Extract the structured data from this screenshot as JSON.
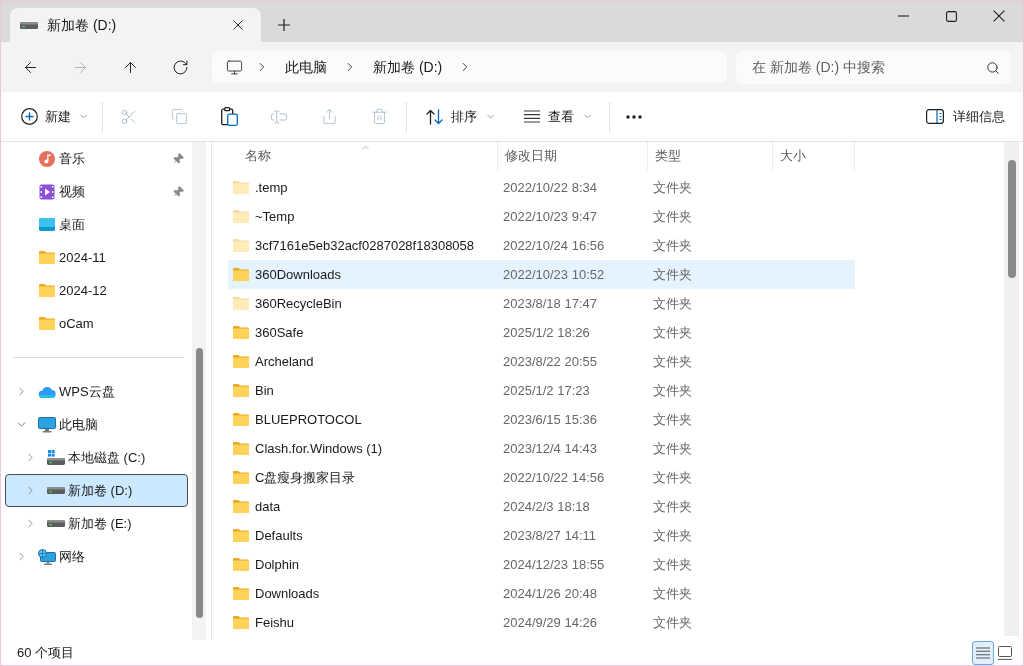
{
  "window": {
    "tabs": [
      {
        "title": "新加卷 (D:)",
        "selected": true
      }
    ]
  },
  "nav_buttons": [
    {
      "kind": "back",
      "disabled": false
    },
    {
      "kind": "forward",
      "disabled": true
    },
    {
      "kind": "up",
      "disabled": false
    },
    {
      "kind": "refresh",
      "disabled": false
    }
  ],
  "address_bar": {
    "path": [
      "此电脑",
      "新加卷 (D:)"
    ]
  },
  "search": {
    "placeholder": "在 新加卷 (D:) 中搜索"
  },
  "toolbar": {
    "new": {
      "label": "新建"
    },
    "actions": [
      {
        "kind": "cut",
        "disabled": true
      },
      {
        "kind": "copy",
        "disabled": true
      },
      {
        "kind": "paste",
        "disabled": false
      },
      {
        "kind": "rename",
        "disabled": true
      },
      {
        "kind": "share",
        "disabled": true
      },
      {
        "kind": "delete",
        "disabled": true
      }
    ],
    "sort": {
      "label": "排序"
    },
    "view": {
      "label": "查看"
    },
    "details": {
      "label": "详细信息"
    }
  },
  "sidebar": {
    "quick_access": [
      {
        "label": "音乐",
        "kind": "music",
        "pinned": true,
        "selected": false
      },
      {
        "label": "视频",
        "kind": "video",
        "pinned": true,
        "selected": false
      },
      {
        "label": "桌面",
        "kind": "desktop",
        "pinned": false,
        "selected": false
      },
      {
        "label": "2024-11",
        "kind": "folder",
        "pinned": false,
        "selected": false
      },
      {
        "label": "2024-12",
        "kind": "folder",
        "pinned": false,
        "selected": false
      },
      {
        "label": "oCam",
        "kind": "folder",
        "pinned": false,
        "selected": false
      }
    ],
    "tree": [
      {
        "label": "WPS云盘",
        "kind": "cloud",
        "expanded": false,
        "selected": false
      },
      {
        "label": "此电脑",
        "kind": "pc",
        "expanded": true,
        "selected": false,
        "children": [
          {
            "label": "本地磁盘 (C:)",
            "kind": "system_drive",
            "expanded": false,
            "selected": false
          },
          {
            "label": "新加卷 (D:)",
            "kind": "drive",
            "expanded": false,
            "selected": true
          },
          {
            "label": "新加卷 (E:)",
            "kind": "drive",
            "expanded": false,
            "selected": false
          }
        ]
      },
      {
        "label": "网络",
        "kind": "network",
        "expanded": false,
        "selected": false
      }
    ]
  },
  "table": {
    "columns": [
      {
        "label": "名称",
        "sorted": true
      },
      {
        "label": "修改日期",
        "sorted": false
      },
      {
        "label": "类型",
        "sorted": false
      },
      {
        "label": "大小",
        "sorted": false
      }
    ],
    "rows": [
      {
        "name": ".temp",
        "modified": "2022/10/22 8:34",
        "type": "文件夹",
        "hidden": true,
        "hovered": false,
        "selected": false
      },
      {
        "name": "~Temp",
        "modified": "2022/10/23 9:47",
        "type": "文件夹",
        "hidden": true,
        "hovered": false,
        "selected": false
      },
      {
        "name": "3cf7161e5eb32acf0287028f18308058",
        "modified": "2022/10/24 16:56",
        "type": "文件夹",
        "hidden": true,
        "hovered": false,
        "selected": false
      },
      {
        "name": "360Downloads",
        "modified": "2022/10/23 10:52",
        "type": "文件夹",
        "hidden": false,
        "hovered": true,
        "selected": false
      },
      {
        "name": "360RecycleBin",
        "modified": "2023/8/18 17:47",
        "type": "文件夹",
        "hidden": true,
        "hovered": false,
        "selected": false
      },
      {
        "name": "360Safe",
        "modified": "2025/1/2 18:26",
        "type": "文件夹",
        "hidden": false,
        "hovered": false,
        "selected": false
      },
      {
        "name": "Archeland",
        "modified": "2023/8/22 20:55",
        "type": "文件夹",
        "hidden": false,
        "hovered": false,
        "selected": false
      },
      {
        "name": "Bin",
        "modified": "2025/1/2 17:23",
        "type": "文件夹",
        "hidden": false,
        "hovered": false,
        "selected": false
      },
      {
        "name": "BLUEPROTOCOL",
        "modified": "2023/6/15 15:36",
        "type": "文件夹",
        "hidden": false,
        "hovered": false,
        "selected": false
      },
      {
        "name": "Clash.for.Windows (1)",
        "modified": "2023/12/4 14:43",
        "type": "文件夹",
        "hidden": false,
        "hovered": false,
        "selected": false
      },
      {
        "name": "C盘瘦身搬家目录",
        "modified": "2022/10/22 14:56",
        "type": "文件夹",
        "hidden": false,
        "hovered": false,
        "selected": false
      },
      {
        "name": "data",
        "modified": "2024/2/3 18:18",
        "type": "文件夹",
        "hidden": false,
        "hovered": false,
        "selected": false
      },
      {
        "name": "Defaults",
        "modified": "2023/8/27 14:11",
        "type": "文件夹",
        "hidden": false,
        "hovered": false,
        "selected": false
      },
      {
        "name": "Dolphin",
        "modified": "2024/12/23 18:55",
        "type": "文件夹",
        "hidden": false,
        "hovered": false,
        "selected": false
      },
      {
        "name": "Downloads",
        "modified": "2024/1/26 20:48",
        "type": "文件夹",
        "hidden": false,
        "hovered": false,
        "selected": false
      },
      {
        "name": "Feishu",
        "modified": "2024/9/29 14:26",
        "type": "文件夹",
        "hidden": false,
        "hovered": false,
        "selected": false
      }
    ]
  },
  "status_bar": {
    "item_count": "60 个项目",
    "views": [
      {
        "kind": "details",
        "selected": true
      },
      {
        "kind": "tiles",
        "selected": false
      }
    ]
  }
}
